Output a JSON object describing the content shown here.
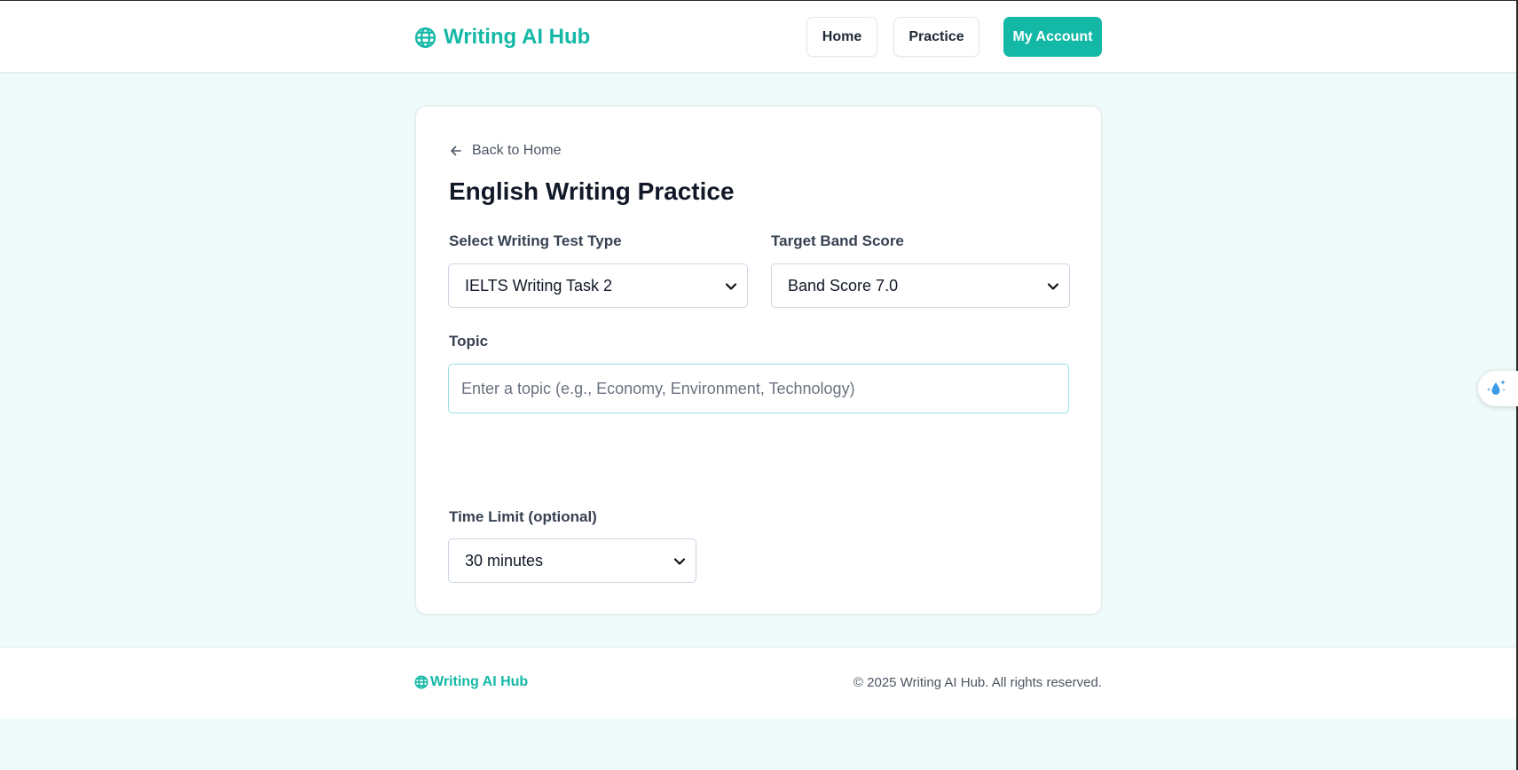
{
  "header": {
    "brand": "Writing AI Hub",
    "nav": {
      "home": "Home",
      "practice": "Practice",
      "account": "My Account"
    }
  },
  "card": {
    "back_link": "Back to Home",
    "title": "English Writing Practice",
    "test_type": {
      "label": "Select Writing Test Type",
      "selected": "IELTS Writing Task 2"
    },
    "band_score": {
      "label": "Target Band Score",
      "selected": "Band Score 7.0"
    },
    "topic": {
      "label": "Topic",
      "value": "",
      "placeholder": "Enter a topic (e.g., Economy, Environment, Technology)"
    },
    "time_limit": {
      "label": "Time Limit (optional)",
      "selected": "30 minutes"
    }
  },
  "footer": {
    "brand": "Writing AI Hub",
    "copyright": "© 2025 Writing AI Hub. All rights reserved."
  },
  "colors": {
    "accent": "#14b8a6",
    "page_background": "#effbfa",
    "widget_icon": "#3b9be8"
  },
  "icons": {
    "brand": "globe-icon",
    "back": "arrow-left-icon",
    "select": "chevron-down-icon",
    "widget": "sparkle-drop-icon"
  }
}
